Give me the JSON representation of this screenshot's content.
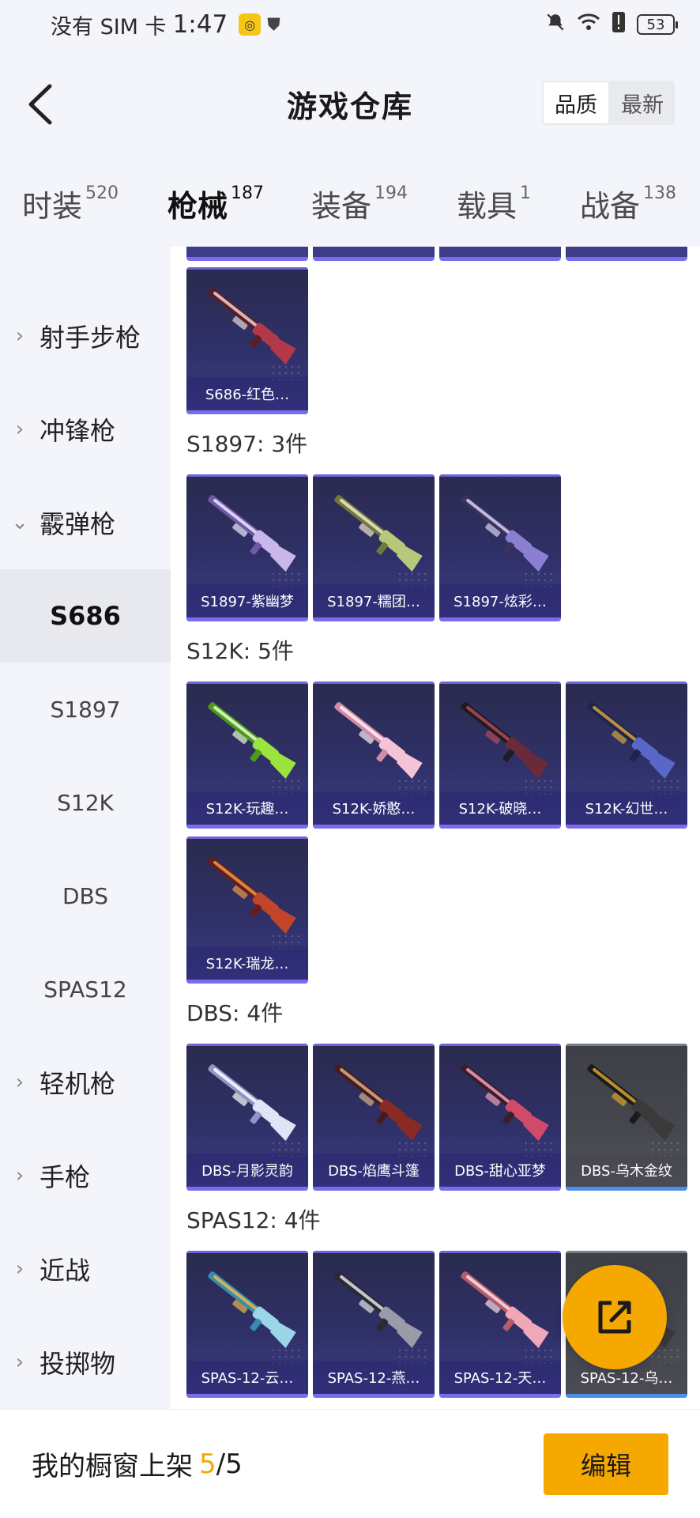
{
  "status_bar": {
    "carrier": "没有 SIM 卡",
    "time": "1:47",
    "battery": "53"
  },
  "header": {
    "title": "游戏仓库",
    "sort_options": [
      "品质",
      "最新"
    ],
    "sort_selected": "品质"
  },
  "tabs": [
    {
      "label": "时装",
      "count": "520"
    },
    {
      "label": "枪械",
      "count": "187"
    },
    {
      "label": "装备",
      "count": "194"
    },
    {
      "label": "载具",
      "count": "1"
    },
    {
      "label": "战备",
      "count": "138"
    }
  ],
  "sidebar": {
    "items": [
      {
        "label": "射手步枪"
      },
      {
        "label": "冲锋枪"
      },
      {
        "label": "霰弹枪"
      },
      {
        "label": "S686"
      },
      {
        "label": "S1897"
      },
      {
        "label": "S12K"
      },
      {
        "label": "DBS"
      },
      {
        "label": "SPAS12"
      },
      {
        "label": "轻机枪"
      },
      {
        "label": "手枪"
      },
      {
        "label": "近战"
      },
      {
        "label": "投掷物"
      }
    ]
  },
  "content": {
    "s686_items": [
      {
        "label": "S686-红色…",
        "colors": [
          "#5b1d24",
          "#b23a48",
          "#e6d6d9"
        ]
      }
    ],
    "groups": [
      {
        "title": "S1897: 3件",
        "items": [
          {
            "label": "S1897-紫幽梦",
            "colors": [
              "#6d5aa8",
              "#c9b7ea",
              "#efe8ff"
            ]
          },
          {
            "label": "S1897-糯团…",
            "colors": [
              "#6f7b3a",
              "#b8c87a",
              "#f2e7d0"
            ]
          },
          {
            "label": "S1897-炫彩…",
            "colors": [
              "#3a3360",
              "#8a7fd0",
              "#d8d3f5"
            ]
          }
        ]
      },
      {
        "title": "S12K: 5件",
        "items": [
          {
            "label": "S12K-玩趣…",
            "colors": [
              "#4f9a1b",
              "#9be33f",
              "#e8ffd0"
            ]
          },
          {
            "label": "S12K-娇憨…",
            "colors": [
              "#d48aa8",
              "#f3c3d6",
              "#fff0f6"
            ]
          },
          {
            "label": "S12K-破晓…",
            "colors": [
              "#1e1b22",
              "#6a2a3a",
              "#b04a5a"
            ]
          },
          {
            "label": "S12K-幻世…",
            "colors": [
              "#1d2450",
              "#5968c8",
              "#d6a23a"
            ]
          },
          {
            "label": "S12K-瑞龙…",
            "colors": [
              "#6a1b1b",
              "#c2452b",
              "#e89a4a"
            ]
          }
        ]
      },
      {
        "title": "DBS: 4件",
        "items": [
          {
            "label": "DBS-月影灵韵",
            "colors": [
              "#8d96c8",
              "#dfe4f7",
              "#ffffff"
            ]
          },
          {
            "label": "DBS-焰鹰斗篷",
            "colors": [
              "#4a1a1a",
              "#8a2a24",
              "#d4b08a"
            ]
          },
          {
            "label": "DBS-甜心亚梦",
            "colors": [
              "#3a1d2a",
              "#d24a6a",
              "#f0a0b8"
            ]
          },
          {
            "label": "DBS-乌木金纹",
            "colors": [
              "#1a1a1a",
              "#3a3a3a",
              "#d6a52a"
            ],
            "gray": true
          }
        ]
      },
      {
        "title": "SPAS12: 4件",
        "items": [
          {
            "label": "SPAS-12-云…",
            "colors": [
              "#3a8bb0",
              "#9ad6e8",
              "#e8b84a"
            ]
          },
          {
            "label": "SPAS-12-燕…",
            "colors": [
              "#2a2a30",
              "#9a9aa8",
              "#e2e2ea"
            ]
          },
          {
            "label": "SPAS-12-天…",
            "colors": [
              "#b85a6a",
              "#f0a8b8",
              "#fbe0e8"
            ]
          },
          {
            "label": "SPAS-12-乌…",
            "colors": [
              "#1a1a1a",
              "#3a3a3a",
              "#d6a52a"
            ],
            "gray": true
          }
        ]
      }
    ]
  },
  "bottom_bar": {
    "label": "我的橱窗上架",
    "current": "5",
    "separator": "/",
    "total": "5",
    "edit_label": "编辑"
  },
  "accent_color": "#f5a800"
}
